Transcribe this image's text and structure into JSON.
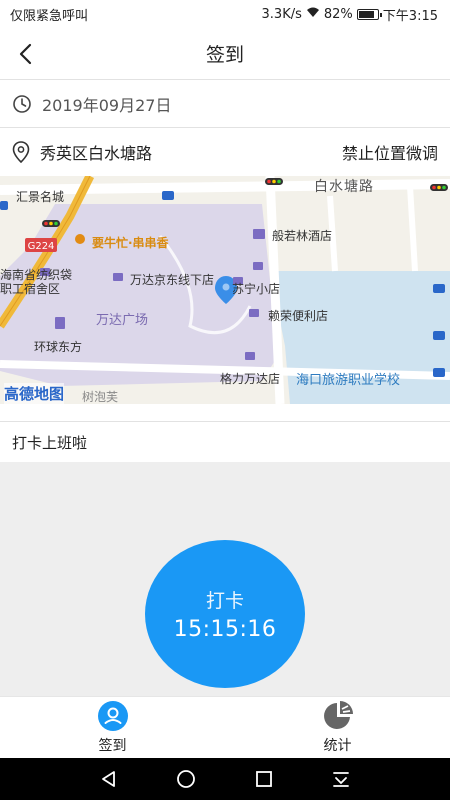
{
  "status_bar": {
    "left_text": "仅限紧急呼叫",
    "net_speed": "3.3K/s",
    "battery_text": "82%",
    "battery_level": 0.82,
    "time": "下午3:15"
  },
  "header": {
    "title": "签到",
    "back_icon": "chevron-left-icon"
  },
  "date_row": {
    "icon": "clock-icon",
    "date": "2019年09月27日"
  },
  "location_row": {
    "icon": "location-pin-icon",
    "address": "秀英区白水塘路",
    "disable_adjust_label": "禁止位置微调"
  },
  "map": {
    "brand": "高德地图",
    "road_label": "白水塘路",
    "highway_label": "G224",
    "pois": [
      "汇景名城",
      "要牛忙·串串香",
      "般若林酒店",
      "万达京东线下店",
      "苏宁小店",
      "海南省纺织袋职工宿舍区",
      "万达广场",
      "赖荣便利店",
      "环球东方",
      "格力万达店",
      "海口旅游职业学校",
      "树泡芙"
    ],
    "colors": {
      "plaza": "#dcd7ea",
      "water": "#cfe3f0",
      "road": "#f0b93a",
      "land": "#f3f1ea"
    }
  },
  "caption": "打卡上班啦",
  "punch": {
    "label": "打卡",
    "time": "15:15:16",
    "color": "#1a98f5"
  },
  "tabs": [
    {
      "label": "签到",
      "icon": "person-pin-icon",
      "active": true,
      "color": "#1a98f5"
    },
    {
      "label": "统计",
      "icon": "pie-chart-icon",
      "active": false,
      "color": "#666666"
    }
  ],
  "android_nav": [
    "back-triangle-icon",
    "home-circle-icon",
    "recents-square-icon",
    "dropdown-notification-icon"
  ]
}
